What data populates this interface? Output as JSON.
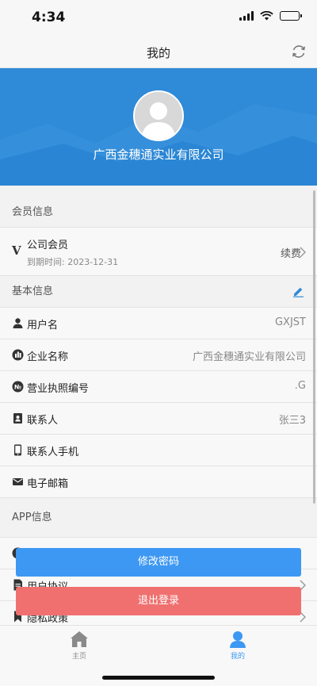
{
  "status_bar": {
    "time": "4:34",
    "battery_level": 0.9
  },
  "nav": {
    "title": "我的"
  },
  "profile": {
    "company": "广西金穗通实业有限公司"
  },
  "membership": {
    "section_title": "会员信息",
    "type": "公司会员",
    "expiry": "到期时间: 2023-12-31",
    "renew_label": "续费"
  },
  "basic_info": {
    "section_title": "基本信息",
    "rows": [
      {
        "label": "用户名",
        "value": "GXJST",
        "icon": "user-icon"
      },
      {
        "label": "企业名称",
        "value": "广西金穗通实业有限公司",
        "icon": "building-icon"
      },
      {
        "label": "营业执照编号",
        "value": ".G",
        "icon": "number-icon"
      },
      {
        "label": "联系人",
        "value": "张三3",
        "icon": "contact-card-icon"
      },
      {
        "label": "联系人手机",
        "value": "",
        "icon": "phone-icon"
      },
      {
        "label": "电子邮箱",
        "value": "",
        "icon": "mail-icon"
      }
    ]
  },
  "app_info": {
    "section_title": "APP信息",
    "rows": [
      {
        "label": "",
        "icon": "info-icon"
      },
      {
        "label": "用户协议",
        "icon": "document-icon"
      },
      {
        "label": "隐私政策",
        "icon": "bookmark-icon"
      }
    ]
  },
  "buttons": {
    "change_password": "修改密码",
    "logout": "退出登录"
  },
  "tabs": [
    {
      "label": "主页",
      "icon": "home-icon",
      "active": false
    },
    {
      "label": "我的",
      "icon": "person-icon",
      "active": true
    }
  ],
  "colors": {
    "header_blue": "#2f8ad8",
    "accent_blue": "#3d98f3",
    "logout_red": "#f07070",
    "tab_inactive": "#8a8a8a"
  }
}
